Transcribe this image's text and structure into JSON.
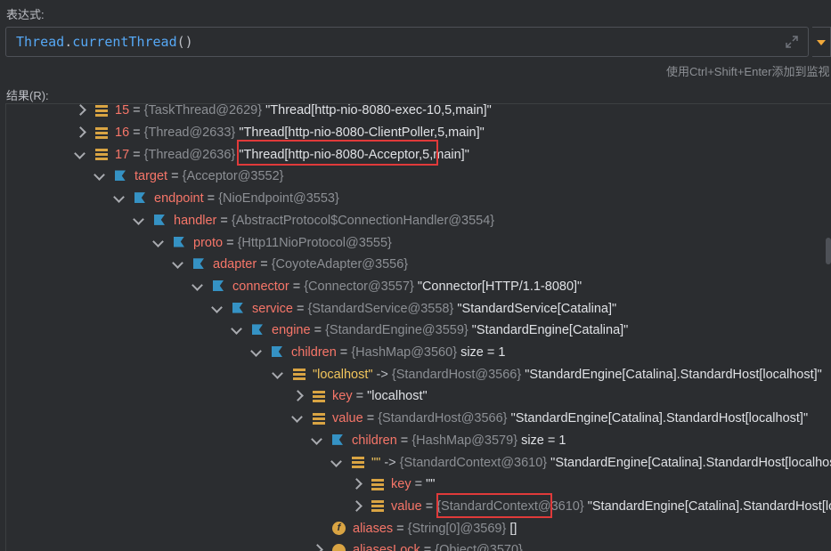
{
  "expression_label": "表达式:",
  "expression": {
    "class_token": "Thread",
    "dot": ".",
    "method_token": "currentThread",
    "parens": "()"
  },
  "hint_text": "使用Ctrl+Shift+Enter添加到监视",
  "result_label": "结果(R):",
  "colors": {
    "background": "#2b2d30",
    "field_name": "#f77669",
    "string_key": "#f2c55c",
    "reference": "#8c8f94",
    "highlight_box": "#e03a3a",
    "accent_dropdown": "#f2a93b"
  },
  "rows": [
    {
      "arrow": "right",
      "icon": "list-icon",
      "name": "15",
      "ref": "{TaskThread@2629}",
      "value": "\"Thread[http-nio-8080-exec-10,5,main]\""
    },
    {
      "arrow": "right",
      "icon": "list-icon",
      "name": "16",
      "ref": "{Thread@2633}",
      "value": "\"Thread[http-nio-8080-ClientPoller,5,main]\""
    },
    {
      "arrow": "down",
      "icon": "list-icon",
      "name": "17",
      "ref": "{Thread@2636}",
      "value": "\"Thread[http-nio-8080-Acceptor,5,main]\""
    },
    {
      "arrow": "down",
      "icon": "field-icon",
      "name": "target",
      "ref": "{Acceptor@3552}",
      "value": ""
    },
    {
      "arrow": "down",
      "icon": "field-icon",
      "name": "endpoint",
      "ref": "{NioEndpoint@3553}",
      "value": ""
    },
    {
      "arrow": "down",
      "icon": "field-icon",
      "name": "handler",
      "ref": "{AbstractProtocol$ConnectionHandler@3554}",
      "value": ""
    },
    {
      "arrow": "down",
      "icon": "field-icon",
      "name": "proto",
      "ref": "{Http11NioProtocol@3555}",
      "value": ""
    },
    {
      "arrow": "down",
      "icon": "field-icon",
      "name": "adapter",
      "ref": "{CoyoteAdapter@3556}",
      "value": ""
    },
    {
      "arrow": "down",
      "icon": "field-icon",
      "name": "connector",
      "ref": "{Connector@3557}",
      "value": "\"Connector[HTTP/1.1-8080]\""
    },
    {
      "arrow": "down",
      "icon": "field-icon",
      "name": "service",
      "ref": "{StandardService@3558}",
      "value": "\"StandardService[Catalina]\""
    },
    {
      "arrow": "down",
      "icon": "field-icon",
      "name": "engine",
      "ref": "{StandardEngine@3559}",
      "value": "\"StandardEngine[Catalina]\""
    },
    {
      "arrow": "down",
      "icon": "field-icon",
      "name": "children",
      "ref": "{HashMap@3560}",
      "value": " size = 1"
    },
    {
      "arrow": "down",
      "icon": "list-icon",
      "name": "\"localhost\"",
      "sep": "->",
      "ref": "{StandardHost@3566}",
      "value": "\"StandardEngine[Catalina].StandardHost[localhost]\""
    },
    {
      "arrow": "right",
      "icon": "list-icon",
      "name": "key",
      "ref": "",
      "value": "\"localhost\""
    },
    {
      "arrow": "down",
      "icon": "list-icon",
      "name": "value",
      "ref": "{StandardHost@3566}",
      "value": "\"StandardEngine[Catalina].StandardHost[localhost]\""
    },
    {
      "arrow": "down",
      "icon": "field-icon",
      "name": "children",
      "ref": "{HashMap@3579}",
      "value": " size = 1"
    },
    {
      "arrow": "down",
      "icon": "list-icon",
      "name": "\"\"",
      "sep": "->",
      "ref": "{StandardContext@3610}",
      "value": "\"StandardEngine[Catalina].StandardHost[localhost].StandardContext[]\""
    },
    {
      "arrow": "right",
      "icon": "list-icon",
      "name": "key",
      "ref": "",
      "value": "\"\""
    },
    {
      "arrow": "right",
      "icon": "list-icon",
      "name": "value",
      "ref": "{StandardContext@3610}",
      "value": "\"StandardEngine[Catalina].StandardHost[localhost].StandardContext[]\""
    },
    {
      "arrow": "",
      "icon": "final-field-icon",
      "name": "aliases",
      "ref": "{String[0]@3569}",
      "value": "[]"
    },
    {
      "arrow": "right",
      "icon": "lock-icon",
      "name": "aliasesLock",
      "ref": "{Object@3570}",
      "value": ""
    }
  ]
}
